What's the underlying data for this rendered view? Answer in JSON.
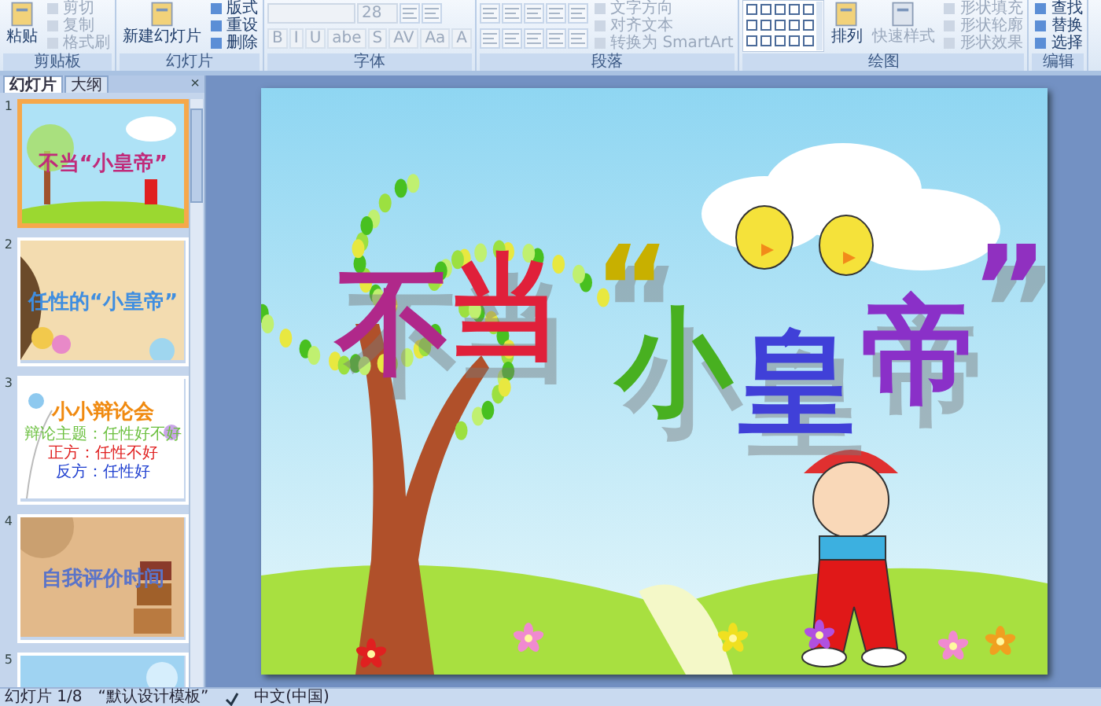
{
  "ribbon": {
    "groups": [
      {
        "label": "剪贴板",
        "columns": [
          [
            {
              "kind": "large",
              "label": "粘贴",
              "disabled": false
            }
          ],
          [
            {
              "kind": "small",
              "label": "剪切",
              "disabled": true
            },
            {
              "kind": "small",
              "label": "复制",
              "disabled": true
            },
            {
              "kind": "small",
              "label": "格式刷",
              "disabled": true
            }
          ]
        ]
      },
      {
        "label": "幻灯片",
        "columns": [
          [
            {
              "kind": "large",
              "label": "新建幻灯片",
              "disabled": false
            }
          ],
          [
            {
              "kind": "small",
              "label": "版式",
              "disabled": false
            },
            {
              "kind": "small",
              "label": "重设",
              "disabled": false
            },
            {
              "kind": "small",
              "label": "删除",
              "disabled": false
            }
          ]
        ]
      },
      {
        "label": "字体",
        "columns": [
          [
            {
              "kind": "row",
              "items": [
                {
                  "kind": "field",
                  "disabled": true
                },
                {
                  "kind": "field",
                  "label": "28",
                  "disabled": true
                },
                {
                  "kind": "icon",
                  "disabled": true
                },
                {
                  "kind": "icon",
                  "disabled": true
                }
              ]
            },
            {
              "kind": "row",
              "items": [
                {
                  "kind": "tool",
                  "label": "B",
                  "disabled": true
                },
                {
                  "kind": "tool",
                  "label": "I",
                  "disabled": true
                },
                {
                  "kind": "tool",
                  "label": "U",
                  "disabled": true
                },
                {
                  "kind": "tool",
                  "label": "abe",
                  "disabled": true
                },
                {
                  "kind": "tool",
                  "label": "S",
                  "disabled": true
                },
                {
                  "kind": "tool",
                  "label": "AV",
                  "disabled": true
                },
                {
                  "kind": "tool",
                  "label": "Aa",
                  "disabled": true
                },
                {
                  "kind": "tool",
                  "label": "A",
                  "disabled": true
                }
              ]
            }
          ]
        ]
      },
      {
        "label": "段落",
        "columns": [
          [
            {
              "kind": "row",
              "items": [
                {
                  "kind": "icon",
                  "disabled": true
                },
                {
                  "kind": "icon",
                  "disabled": true
                },
                {
                  "kind": "icon",
                  "disabled": true
                },
                {
                  "kind": "icon",
                  "disabled": true
                },
                {
                  "kind": "icon",
                  "disabled": true
                }
              ]
            },
            {
              "kind": "row",
              "items": [
                {
                  "kind": "icon",
                  "disabled": true
                },
                {
                  "kind": "icon",
                  "disabled": true
                },
                {
                  "kind": "icon",
                  "disabled": true
                },
                {
                  "kind": "icon",
                  "disabled": true
                },
                {
                  "kind": "icon",
                  "disabled": true
                }
              ]
            }
          ],
          [
            {
              "kind": "small",
              "label": "文字方向",
              "disabled": true
            },
            {
              "kind": "small",
              "label": "对齐文本",
              "disabled": true
            },
            {
              "kind": "small",
              "label": "转换为 SmartArt",
              "disabled": true
            }
          ]
        ]
      },
      {
        "label": "绘图",
        "columns": [
          [
            {
              "kind": "gallery",
              "disabled": false
            }
          ],
          [
            {
              "kind": "large",
              "label": "排列",
              "disabled": false
            }
          ],
          [
            {
              "kind": "large",
              "label": "快速样式",
              "disabled": true
            }
          ],
          [
            {
              "kind": "small",
              "label": "形状填充",
              "disabled": true
            },
            {
              "kind": "small",
              "label": "形状轮廓",
              "disabled": true
            },
            {
              "kind": "small",
              "label": "形状效果",
              "disabled": true
            }
          ]
        ]
      },
      {
        "label": "编辑",
        "columns": [
          [
            {
              "kind": "small",
              "label": "查找",
              "disabled": false
            },
            {
              "kind": "small",
              "label": "替换",
              "disabled": false
            },
            {
              "kind": "small",
              "label": "选择",
              "disabled": false
            }
          ]
        ]
      }
    ]
  },
  "pane": {
    "tabs": [
      {
        "label": "幻灯片",
        "selected": true
      },
      {
        "label": "大纲",
        "selected": false
      }
    ],
    "close": "×",
    "thumbnails": [
      {
        "number": "1",
        "selected": true,
        "kind": "cover",
        "texts": [
          "不当“小皇帝”"
        ]
      },
      {
        "number": "2",
        "selected": false,
        "kind": "paper",
        "texts": [
          "任性的“小皇帝”"
        ]
      },
      {
        "number": "3",
        "selected": false,
        "kind": "debate",
        "texts": [
          "小小辩论会",
          "辩论主题：任性好不好",
          "正方：任性不好",
          "反方：任性好"
        ]
      },
      {
        "number": "4",
        "selected": false,
        "kind": "cups",
        "texts": [
          "自我评价时间"
        ]
      },
      {
        "number": "5",
        "selected": false,
        "kind": "blue"
      }
    ]
  },
  "slide": {
    "title": [
      {
        "text": "不",
        "color": "#b0288a"
      },
      {
        "text": "当",
        "color": "#e0203a"
      },
      {
        "text": "“",
        "color": "#c8b000"
      },
      {
        "text": "小",
        "color": "#48b020"
      },
      {
        "text": "皇",
        "color": "#4040d8"
      },
      {
        "text": "帝",
        "color": "#8a30c8"
      },
      {
        "text": "”",
        "color": "#9030c0"
      }
    ]
  },
  "status_bar": {
    "slide": "幻灯片 1/8",
    "theme": "“默认设计模板”",
    "language": "中文(中国)"
  }
}
